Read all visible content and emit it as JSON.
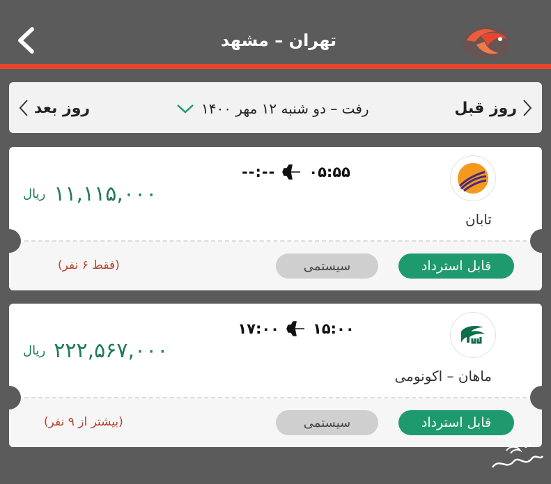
{
  "header": {
    "title": "تهران – مشهد",
    "back_icon": "chevron-left-icon",
    "logo_icon": "brand-logo-icon",
    "accent_color": "#e8452e"
  },
  "date_bar": {
    "next_day_label": "روز بعد",
    "prev_day_label": "روز قبل",
    "date_text": "رفت – دو شنبه ۱۲ مهر ۱۴۰۰"
  },
  "flights": [
    {
      "airline": "تابان",
      "departure": "۰۵:۵۵",
      "arrival": "--:--",
      "price": "۱۱,۱۱۵,۰۰۰",
      "currency": "ریال",
      "refund_label": "قابل استرداد",
      "type_label": "سیستمی",
      "seats_label": "(فقط ۶ نفر)"
    },
    {
      "airline": "ماهان – اکونومی",
      "departure": "۱۵:۰۰",
      "arrival": "۱۷:۰۰",
      "price": "۲۲۲,۵۶۷,۰۰۰",
      "currency": "ریال",
      "refund_label": "قابل استرداد",
      "type_label": "سیستمی",
      "seats_label": "(بیشتر از ۹ نفر)"
    }
  ],
  "colors": {
    "price": "#1f7a5c",
    "refund_button": "#1f9a6f",
    "seats_text": "#b5462f"
  }
}
